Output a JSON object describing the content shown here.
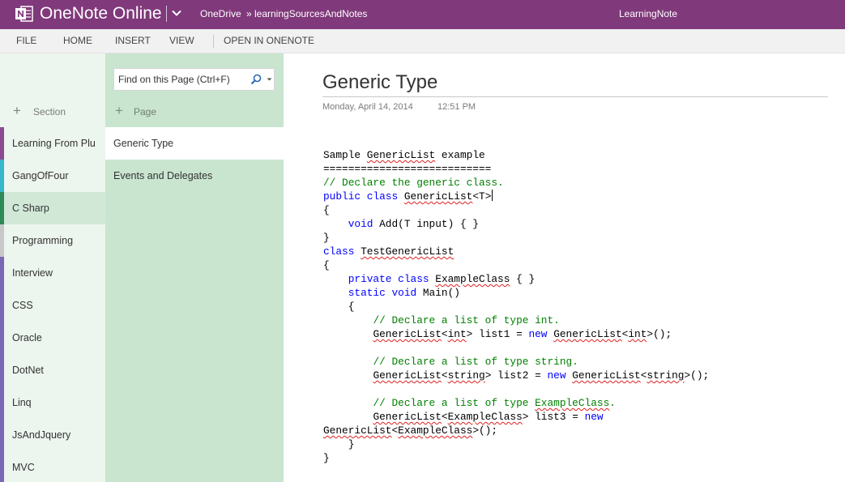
{
  "header": {
    "app_title": "OneNote Online",
    "breadcrumb": [
      "OneDrive",
      "learningSourcesAndNotes"
    ],
    "breadcrumb_separator": "»",
    "notebook": "LearningNote",
    "brand_color": "#80397b"
  },
  "ribbon": {
    "tabs": [
      "FILE",
      "HOME",
      "INSERT",
      "VIEW"
    ],
    "open_in": "OPEN IN ONENOTE"
  },
  "sections": {
    "add_label": "Section",
    "active_index": 2,
    "items": [
      {
        "label": "Learning From Plu",
        "color": "#8e4a91"
      },
      {
        "label": "GangOfFour",
        "color": "#35b8c9"
      },
      {
        "label": "C Sharp",
        "color": "#2e8b57"
      },
      {
        "label": "Programming",
        "color": "#c8c8c8"
      },
      {
        "label": "Interview",
        "color": "#7b68b5"
      },
      {
        "label": "CSS",
        "color": "#7b68b5"
      },
      {
        "label": "Oracle",
        "color": "#7b68b5"
      },
      {
        "label": "DotNet",
        "color": "#7b68b5"
      },
      {
        "label": "Linq",
        "color": "#7b68b5"
      },
      {
        "label": "JsAndJquery",
        "color": "#7b68b5"
      },
      {
        "label": "MVC",
        "color": "#7b68b5"
      }
    ]
  },
  "pages": {
    "search_placeholder": "Find on this Page (Ctrl+F)",
    "add_label": "Page",
    "active_index": 0,
    "items": [
      "Generic Type",
      "Events and Delegates"
    ]
  },
  "note": {
    "title": "Generic Type",
    "date": "Monday, April 14, 2014",
    "time": "12:51 PM",
    "code_lines": [
      "Sample GenericList example",
      "===========================",
      "// Declare the generic class.",
      "public class GenericList<T>",
      "{",
      "    void Add(T input) { }",
      "}",
      "class TestGenericList",
      "{",
      "    private class ExampleClass { }",
      "    static void Main()",
      "    {",
      "        // Declare a list of type int.",
      "        GenericList<int> list1 = new GenericList<int>();",
      "",
      "        // Declare a list of type string.",
      "        GenericList<string> list2 = new GenericList<string>();",
      "",
      "        // Declare a list of type ExampleClass.",
      "        GenericList<ExampleClass> list3 = new",
      "GenericList<ExampleClass>();",
      "    }",
      "}"
    ]
  }
}
